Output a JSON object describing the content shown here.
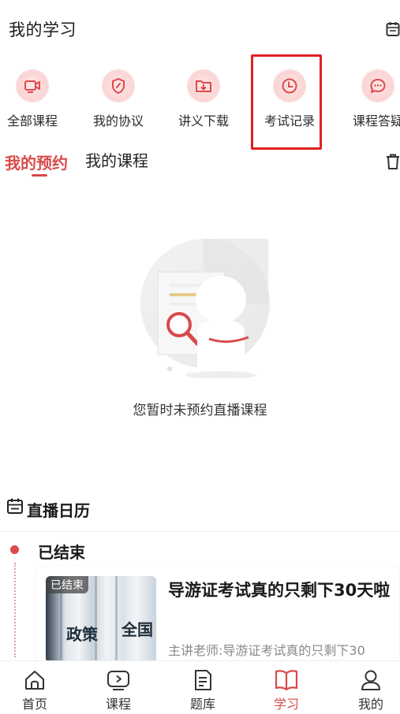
{
  "header": {
    "title": "我的学习"
  },
  "quick_actions": [
    {
      "label": "全部课程",
      "icon": "video-camera-icon"
    },
    {
      "label": "我的协议",
      "icon": "shield-icon"
    },
    {
      "label": "讲义下载",
      "icon": "folder-download-icon"
    },
    {
      "label": "考试记录",
      "icon": "clock-icon"
    },
    {
      "label": "课程答疑",
      "icon": "chat-bubble-icon"
    }
  ],
  "tabs": {
    "active": "我的预约",
    "other": "我的课程"
  },
  "empty_state": {
    "text": "您暂时未预约直播课程"
  },
  "calendar": {
    "title": "直播日历",
    "status": "已结束",
    "card": {
      "badge": "已结束",
      "title": "导游证考试真的只剩下30天啦",
      "teacher": "主讲老师:导游证考试真的只剩下30",
      "thumb_text_1": "政策",
      "thumb_text_2": "全国"
    }
  },
  "bottom_nav": [
    {
      "label": "首页",
      "icon": "home-icon"
    },
    {
      "label": "课程",
      "icon": "play-icon"
    },
    {
      "label": "题库",
      "icon": "question-bank-icon"
    },
    {
      "label": "学习",
      "icon": "book-icon",
      "active": true
    },
    {
      "label": "我的",
      "icon": "user-icon"
    }
  ],
  "colors": {
    "accent": "#d94a4a",
    "highlight_box": "#e02020"
  }
}
